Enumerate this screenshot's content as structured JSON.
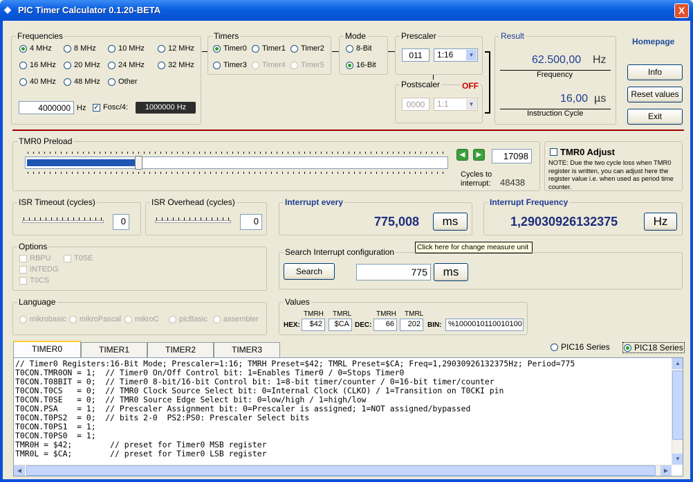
{
  "window": {
    "title": "PIC Timer Calculator 0.1.20-BETA",
    "close": "X",
    "icon": "microchip-icon"
  },
  "frequencies": {
    "title": "Frequencies",
    "options": [
      "4 MHz",
      "8 MHz",
      "10 MHz",
      "12 MHz",
      "16 MHz",
      "20 MHz",
      "24 MHz",
      "32 MHz",
      "40 MHz",
      "48 MHz",
      "Other"
    ],
    "selected": "4 MHz",
    "value": "4000000",
    "unit": "Hz",
    "fosc_label": "Fosc/4:",
    "fosc_value": "1000000  Hz"
  },
  "timers": {
    "title": "Timers",
    "options": [
      "Timer0",
      "Timer1",
      "Timer2",
      "Timer3",
      "Timer4",
      "Timer5"
    ],
    "selected": "Timer0"
  },
  "mode": {
    "title": "Mode",
    "options": [
      "8-Bit",
      "16-Bit"
    ],
    "selected": "16-Bit"
  },
  "prescaler": {
    "title": "Prescaler",
    "bits": "011",
    "ratio": "1:16"
  },
  "postscaler": {
    "title": "Postscaler",
    "state": "OFF",
    "bits": "0000",
    "ratio": "1:1"
  },
  "result": {
    "title": "Result",
    "frequency_value": "62.500,00",
    "frequency_unit": "Hz",
    "frequency_label": "Frequency",
    "cycle_value": "16,00",
    "cycle_unit": "µs",
    "cycle_label": "Instruction Cycle"
  },
  "side": {
    "homepage": "Homepage",
    "info": "Info",
    "reset": "Reset values",
    "exit": "Exit"
  },
  "preload": {
    "title": "TMR0 Preload",
    "value": "17098",
    "cycles_label": "Cycles to\ninterrupt:",
    "cycles_value": "48438",
    "slider_fraction": 0.26
  },
  "adjust": {
    "title": "TMR0 Adjust",
    "note": "NOTE: Due the two cycle loss when TMR0 register is written, you can adjust here the register value i.e. when used as period time counter."
  },
  "isr_timeout": {
    "title": "ISR Timeout (cycles)",
    "value": "0"
  },
  "isr_overhead": {
    "title": "ISR Overhead  (cycles)",
    "value": "0"
  },
  "interrupt_every": {
    "title": "Interrupt every",
    "value": "775,008",
    "unit": "ms"
  },
  "interrupt_freq": {
    "title": "Interrupt Frequency",
    "value": "1,29030926132375",
    "unit": "Hz"
  },
  "tooltip": "Click here for change measure unit",
  "options": {
    "title": "Options",
    "items": [
      "RBPU",
      "T0SE",
      "INTEDG",
      "T0CS"
    ]
  },
  "search": {
    "title": "Search Interrupt configuration",
    "button": "Search",
    "value": "775",
    "unit": "ms"
  },
  "language": {
    "title": "Language",
    "items": [
      "mikrobasic",
      "mikroPascal",
      "mikroC",
      "picBasic",
      "assembler"
    ]
  },
  "values": {
    "title": "Values",
    "hex_label": "HEX:",
    "dec_label": "DEC:",
    "bin_label": "BIN:",
    "tmrh": "TMRH",
    "tmrl": "TMRL",
    "hex_h": "$42",
    "hex_l": "$CA",
    "dec_h": "66",
    "dec_l": "202",
    "bin": "%1000010110010100"
  },
  "tabs": [
    "TIMER0",
    "TIMER1",
    "TIMER2",
    "TIMER3"
  ],
  "series": {
    "options": [
      "PIC16 Series",
      "PIC18 Series"
    ],
    "selected": "PIC18 Series"
  },
  "code": [
    "// Timer0 Registers:16-Bit Mode; Prescaler=1:16; TMRH Preset=$42; TMRL Preset=$CA; Freq=1,29030926132375Hz; Period=775",
    "T0CON.TMR0ON = 1;  // Timer0 On/Off Control bit: 1=Enables Timer0 / 0=Stops Timer0",
    "T0CON.T08BIT = 0;  // Timer0 8-bit/16-bit Control bit: 1=8-bit timer/counter / 0=16-bit timer/counter",
    "T0CON.T0CS   = 0;  // TMR0 Clock Source Select bit: 0=Internal Clock (CLKO) / 1=Transition on T0CKI pin",
    "T0CON.T0SE   = 0;  // TMR0 Source Edge Select bit: 0=low/high / 1=high/low",
    "T0CON.PSA    = 1;  // Prescaler Assignment bit: 0=Prescaler is assigned; 1=NOT assigned/bypassed",
    "T0CON.T0PS2  = 0;  // bits 2-0  PS2:PS0: Prescaler Select bits",
    "T0CON.T0PS1  = 1;",
    "T0CON.T0PS0  = 1;",
    "TMR0H = $42;        // preset for Timer0 MSB register",
    "TMR0L = $CA;        // preset for Timer0 LSB register"
  ]
}
